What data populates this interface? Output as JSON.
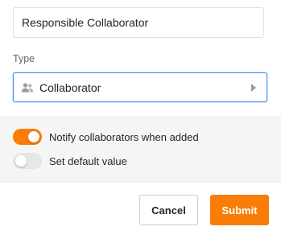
{
  "form": {
    "name_value": "Responsible Collaborator",
    "type_label": "Type",
    "type_value": "Collaborator",
    "type_icon": "people-icon"
  },
  "options": {
    "notify_label": "Notify collaborators when added",
    "notify_enabled": true,
    "default_label": "Set default value",
    "default_enabled": false
  },
  "buttons": {
    "cancel_label": "Cancel",
    "submit_label": "Submit"
  },
  "colors": {
    "accent": "#f97d06",
    "focus_border": "#4d8cf5"
  }
}
